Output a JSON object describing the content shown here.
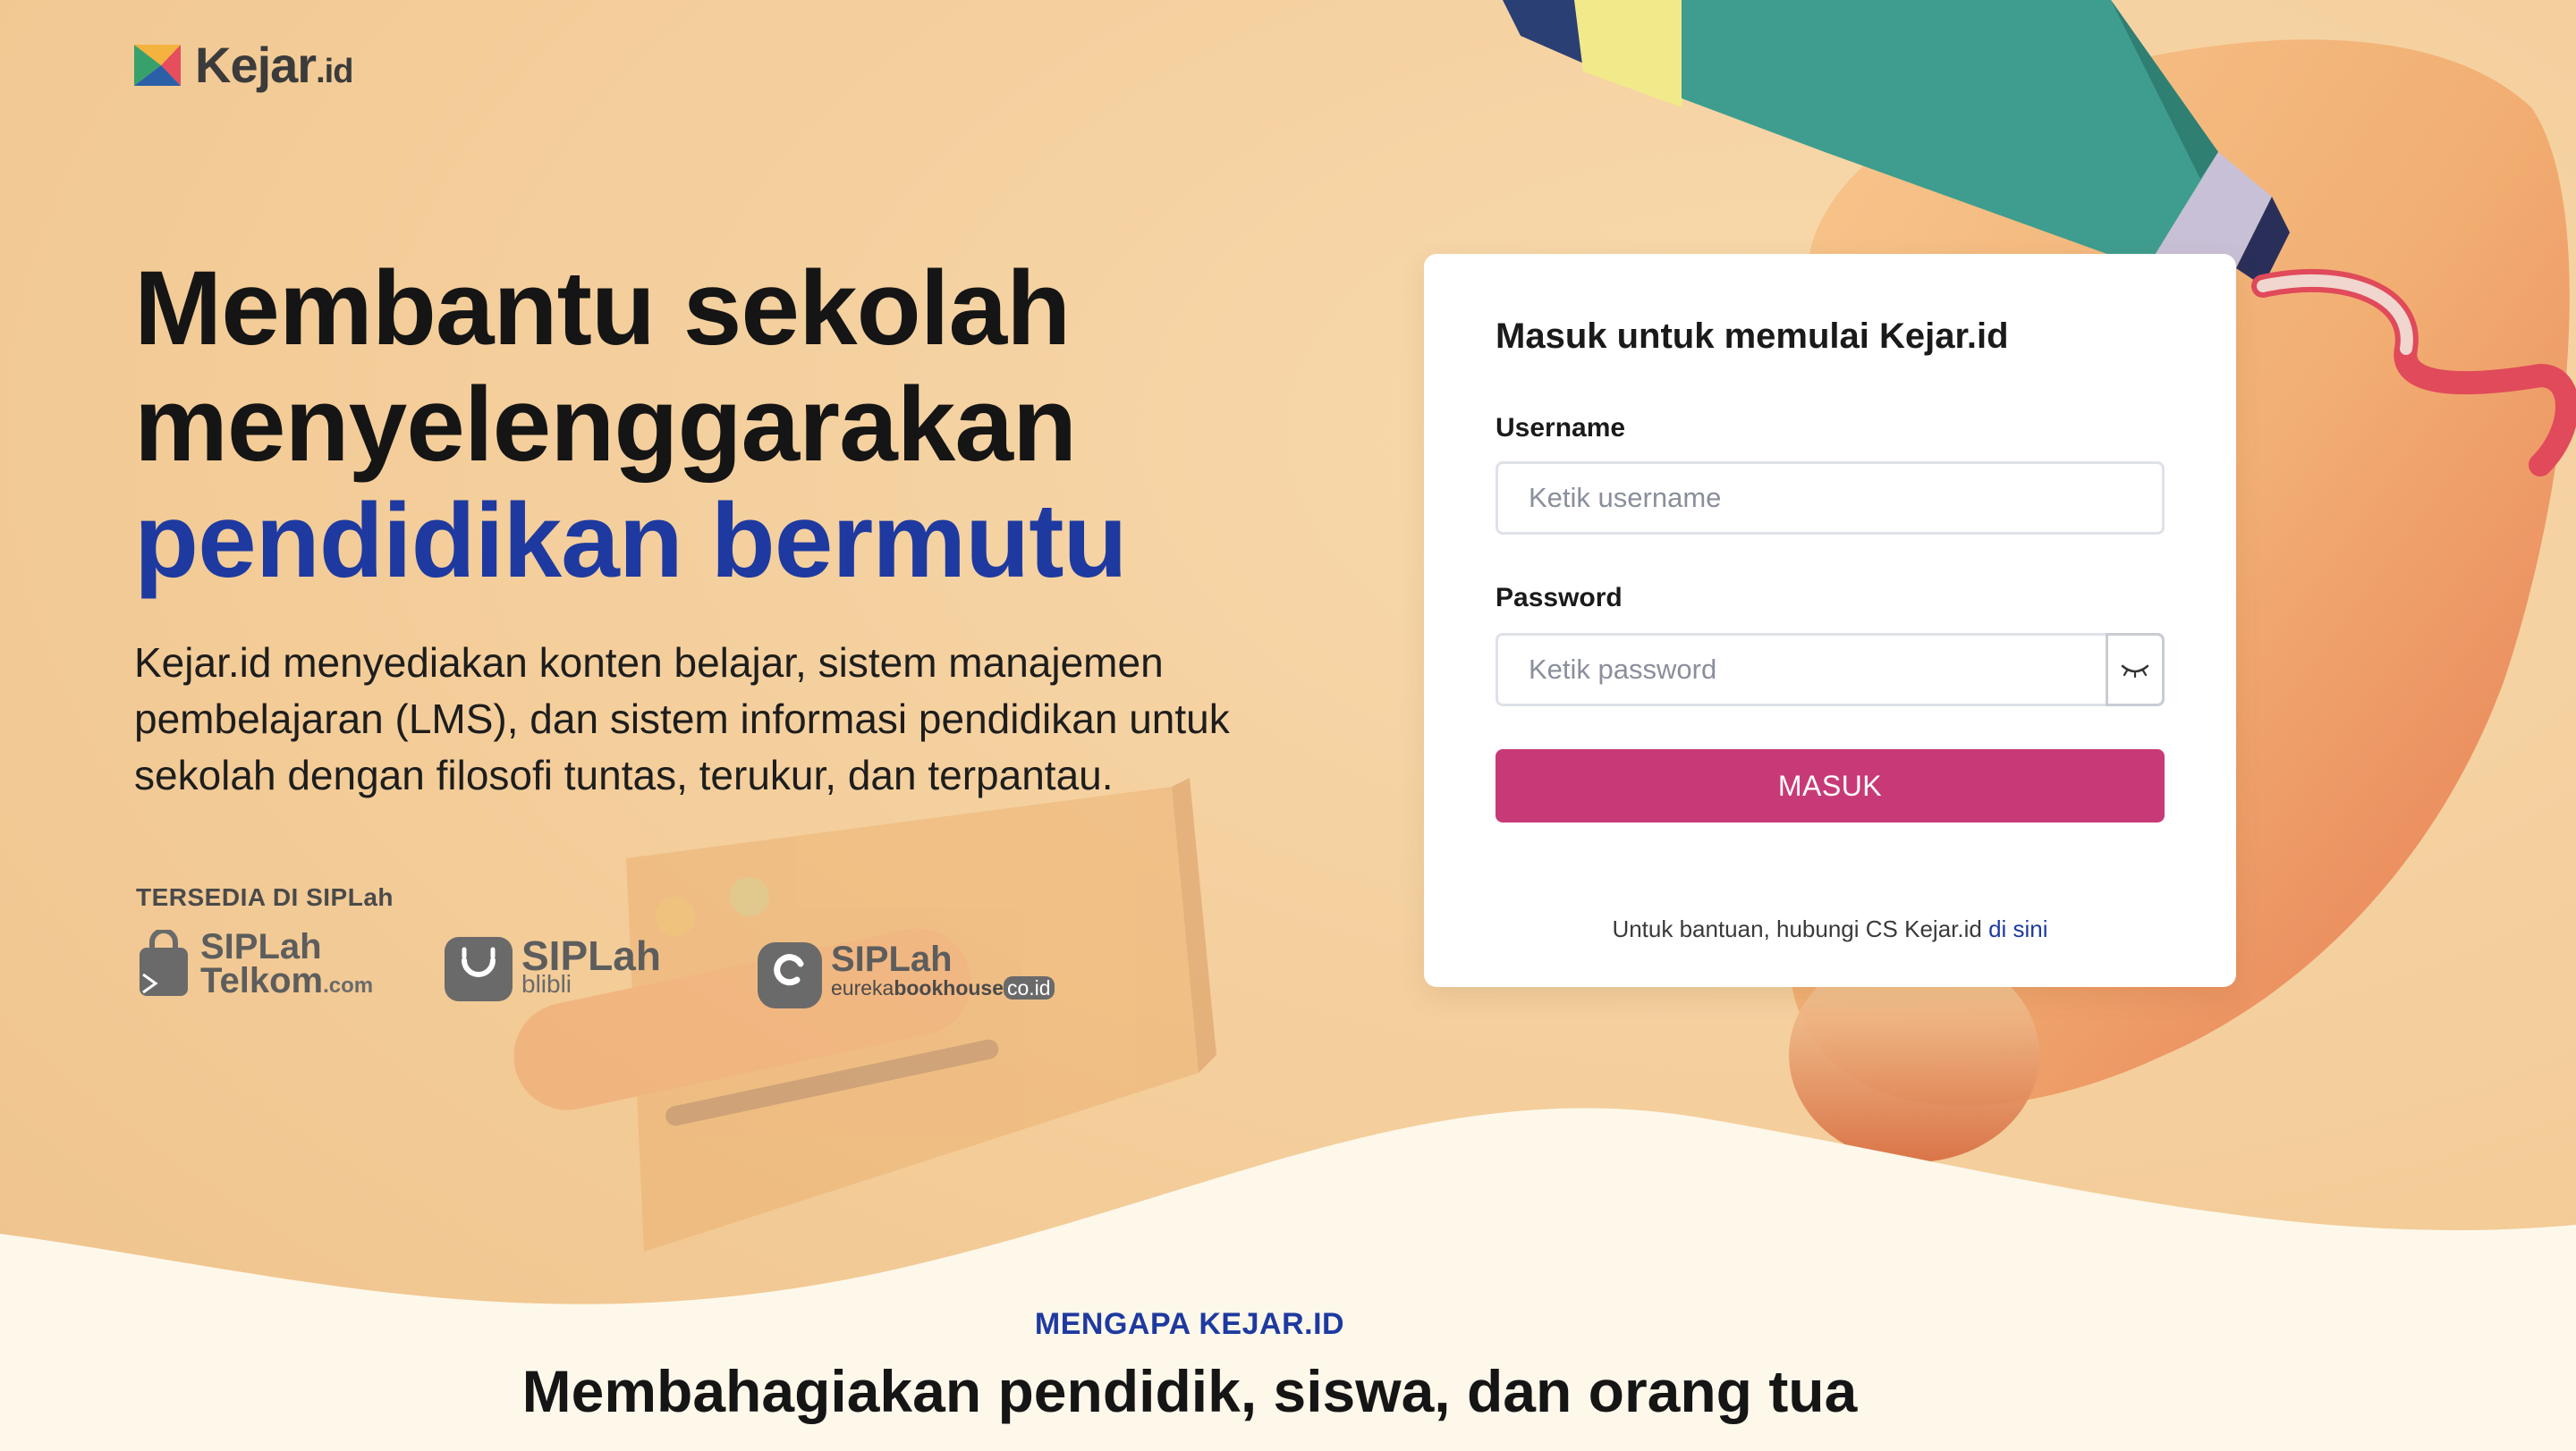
{
  "brand": {
    "name": "Kejar",
    "suffix": ".id",
    "colors": {
      "primary": "#1e3aa0",
      "button": "#c83a77",
      "background": "#f6d2a2",
      "cream": "#fdf8ea"
    }
  },
  "hero": {
    "line1": "Membantu sekolah",
    "line2": "menyelenggarakan",
    "accent": "pendidikan bermutu",
    "description": "Kejar.id menyediakan konten belajar, sistem manajemen pembelajaran (LMS), dan sistem informasi pendidikan untuk sekolah dengan filosofi tuntas, terukur, dan terpantau."
  },
  "siplah": {
    "label": "TERSEDIA DI SIPLah",
    "partners": [
      {
        "top": "SIPLah",
        "bottom": "Telkom",
        "tld": ".com",
        "icon": "shopping-bag-icon"
      },
      {
        "top": "SIPLah",
        "bottom": "blibli",
        "icon": "smile-bag-icon"
      },
      {
        "top": "SIPLah",
        "bottom_a": "eureka",
        "bottom_b": "bookhouse",
        "tld": "co.id",
        "icon": "eureka-logo-icon"
      }
    ]
  },
  "login": {
    "title": "Masuk untuk memulai Kejar.id",
    "username_label": "Username",
    "username_placeholder": "Ketik username",
    "password_label": "Password",
    "password_placeholder": "Ketik password",
    "submit_label": "MASUK",
    "help_text": "Untuk bantuan, hubungi CS Kejar.id ",
    "help_link": "di sini"
  },
  "why": {
    "eyebrow": "MENGAPA KEJAR.ID",
    "title": "Membahagiakan pendidik, siswa, dan orang tua"
  }
}
